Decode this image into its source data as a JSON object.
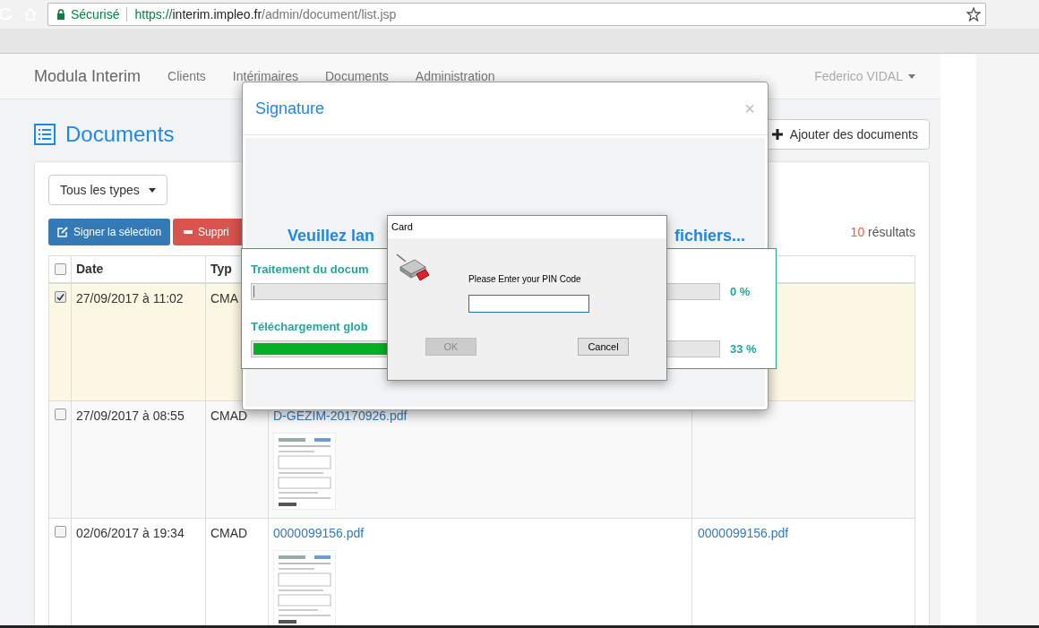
{
  "browser": {
    "security_label": "Sécurisé",
    "url_scheme": "https://",
    "url_host": "interim.impleo.fr",
    "url_path": "/admin/document/list.jsp",
    "bookmarked": false
  },
  "navbar": {
    "brand": "Modula Interim",
    "items": [
      {
        "label": "Clients",
        "selected": false
      },
      {
        "label": "Intérimaires",
        "selected": false
      },
      {
        "label": "Documents",
        "selected": false
      },
      {
        "label": "Administration",
        "selected": false
      }
    ],
    "user": "Federico VIDAL"
  },
  "page": {
    "title": "Documents",
    "add_button": "Ajouter des documents"
  },
  "filters": {
    "type_dropdown": "Tous les types",
    "sign_button": "Signer la sélection",
    "delete_button": "Suppri",
    "results_count": "10",
    "results_label": "résultats"
  },
  "table": {
    "all_selected": false,
    "columns": [
      "Date",
      "Typ"
    ],
    "rows": [
      {
        "selected": true,
        "date": "27/09/2017 à 11:02",
        "type": "CMA"
      },
      {
        "selected": false,
        "date": "27/09/2017 à 08:55",
        "type": "CMAD",
        "file": "D-GEZIM-20170926.pdf"
      },
      {
        "selected": false,
        "date": "02/06/2017 à 19:34",
        "type": "CMAD",
        "file": "0000099156.pdf",
        "column_4": "0000099156.pdf"
      }
    ]
  },
  "signature_modal": {
    "title": "Signature",
    "close": "×",
    "heading_start": "Veuillez lan",
    "heading_end": "fichiers...",
    "progress": [
      {
        "label": "Traitement du docum",
        "level": 0,
        "reading": "0 %"
      },
      {
        "label": "Téléchargement glob",
        "level": 0.33,
        "reading": "33 %"
      }
    ]
  },
  "card_dialog": {
    "title": "Card",
    "prompt": "Please Enter your PIN Code",
    "ok_button": "OK",
    "ok_disabled": true,
    "cancel_button": "Cancel"
  }
}
